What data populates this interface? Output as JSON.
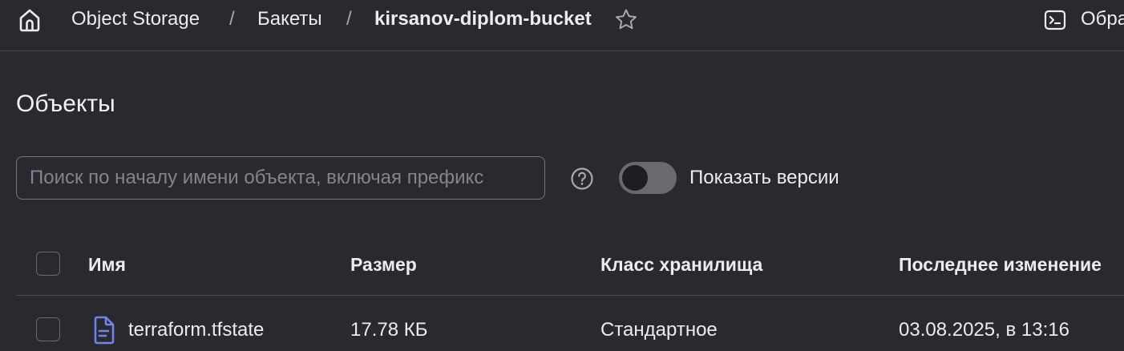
{
  "breadcrumb": {
    "items": [
      "Object Storage",
      "Бакеты"
    ],
    "current": "kirsanov-diplom-bucket",
    "separator": "/"
  },
  "header_action": {
    "label": "Обра"
  },
  "page": {
    "title": "Объекты"
  },
  "search": {
    "placeholder": "Поиск по началу имени объекта, включая префикс",
    "value": ""
  },
  "versions_toggle": {
    "label": "Показать версии",
    "enabled": false
  },
  "table": {
    "columns": [
      "Имя",
      "Размер",
      "Класс хранилища",
      "Последнее изменение"
    ],
    "rows": [
      {
        "name": "terraform.tfstate",
        "size": "17.78 КБ",
        "storage_class": "Стандартное",
        "modified": "03.08.2025, в 13:16"
      }
    ]
  },
  "icons": {
    "home": "home-icon",
    "star": "star-icon",
    "console": "terminal-icon",
    "help": "question-circle-icon",
    "file": "file-document-icon"
  },
  "colors": {
    "background": "#2a2930",
    "file_icon": "#6f86e8",
    "text": "#ececec"
  }
}
